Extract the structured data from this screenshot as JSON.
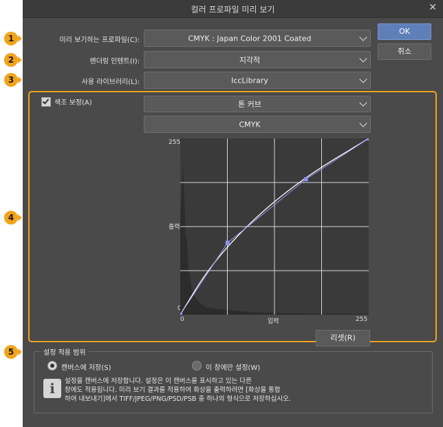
{
  "window": {
    "title": "컬러 프로파일 미리 보기",
    "close_glyph": "✕"
  },
  "form": {
    "profile": {
      "label": "미리 보기하는 프로파일(C):",
      "value": "CMYK : Japan Color 2001 Coated"
    },
    "intent": {
      "label": "렌더링 인텐트(I):",
      "value": "지각적"
    },
    "library": {
      "label": "사용 라이브러리(L):",
      "value": "IccLibrary"
    }
  },
  "buttons": {
    "ok": "OK",
    "cancel": "취소",
    "reset": "리셋(R)"
  },
  "badges": [
    "1",
    "2",
    "3",
    "4",
    "5"
  ],
  "color_correction": {
    "checkbox_label": "색조 보정(A)",
    "checked": true,
    "mode_value": "톤 커브",
    "channel_value": "CMYK"
  },
  "chart_data": {
    "type": "line",
    "xlabel": "입력",
    "ylabel": "출력",
    "xlim": [
      0,
      255
    ],
    "ylim": [
      0,
      255
    ],
    "x_ticks": [
      "0",
      "255"
    ],
    "y_ticks": [
      "255",
      "0"
    ],
    "grid": true,
    "series": [
      {
        "values": [
          [
            0,
            0
          ],
          [
            64,
            104
          ],
          [
            170,
            196
          ],
          [
            255,
            255
          ]
        ]
      }
    ],
    "default_curve": [
      [
        0,
        0
      ],
      [
        40,
        70
      ],
      [
        100,
        140
      ],
      [
        170,
        200
      ],
      [
        255,
        255
      ]
    ]
  },
  "scope": {
    "title": "설정 적용 범위",
    "option_save": "캔버스에 저장(S)",
    "option_view": "이 창에만 설정(W)",
    "selected": "save",
    "info_glyph": "i",
    "info_line1": "설정을 캔버스에 저장합니다. 설정은 이 캔버스를 표시하고 있는 다른",
    "info_line2": "창에도 적용됩니다. 미리 보기 결과를 적용하여 화상을 출력하려면 [화상을 통합",
    "info_line3": "하여 내보내기]에서 TIFF/JPEG/PNG/PSD/PSB 중 하나의 형식으로 저장하십시오."
  },
  "colors": {
    "accent": "#f2a31b",
    "ok_button": "#5f7fb8",
    "curve_point": "#8f8ff0",
    "panel": "#4a4a4a"
  }
}
